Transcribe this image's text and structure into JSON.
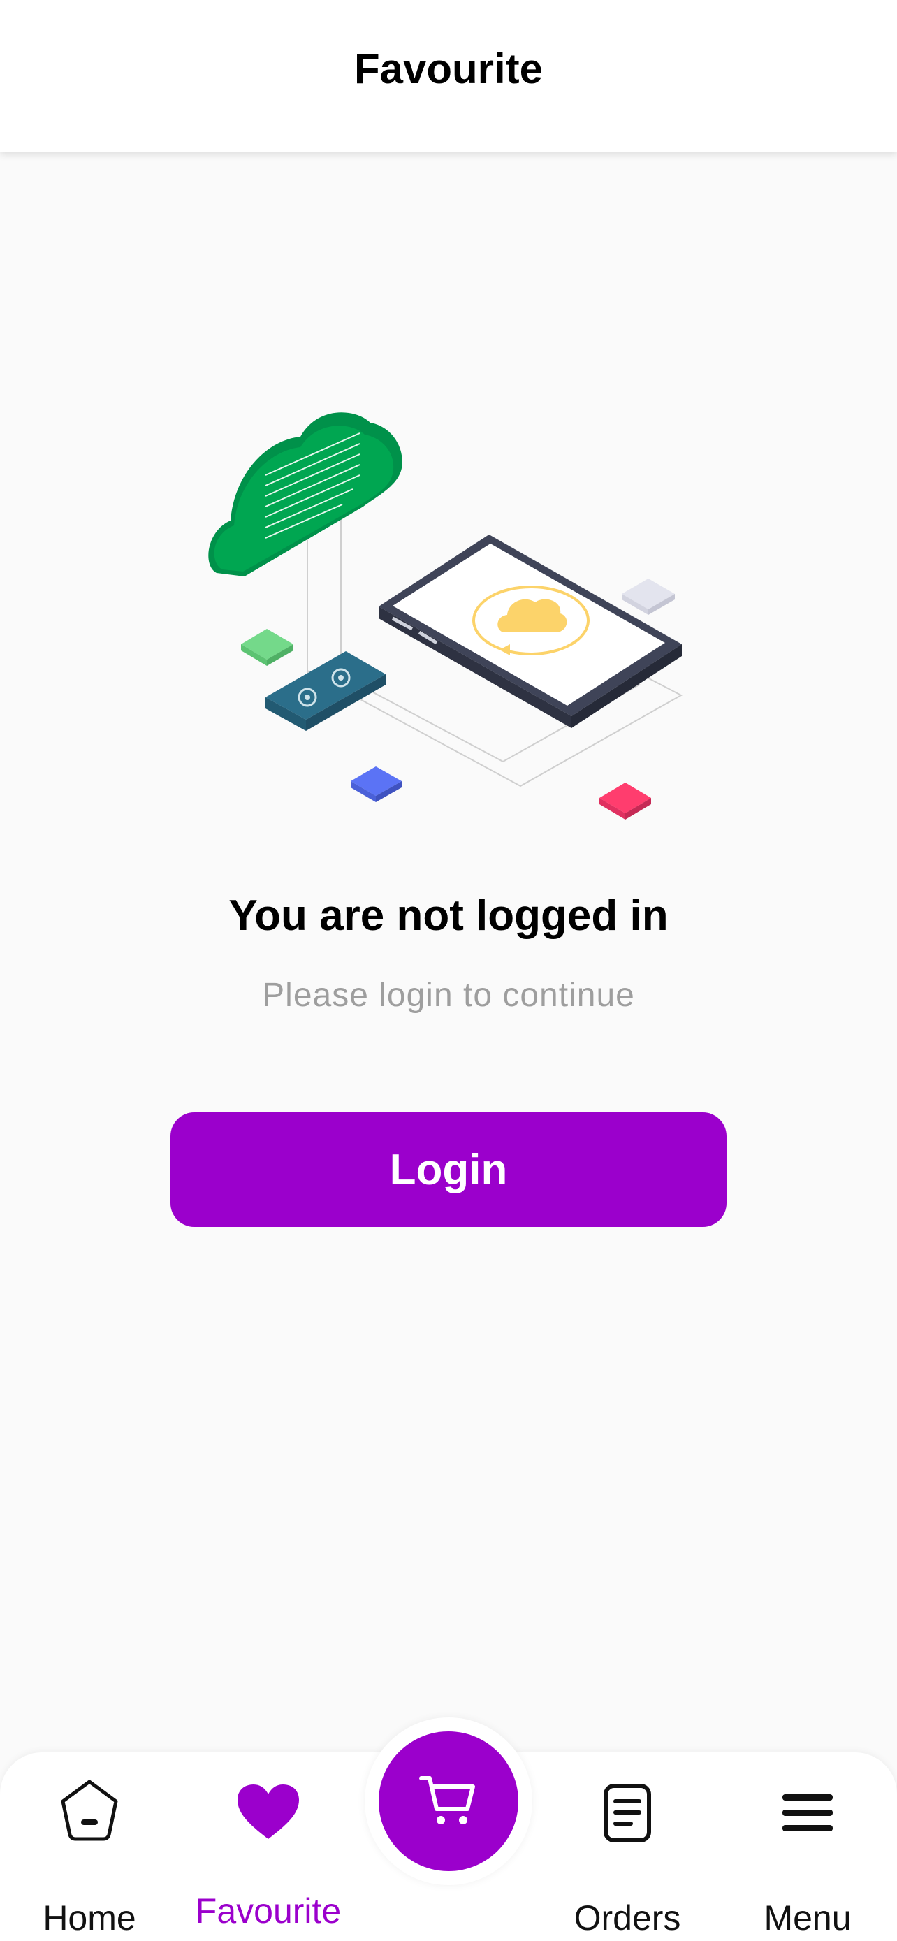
{
  "header": {
    "title": "Favourite"
  },
  "empty_state": {
    "title": "You are not logged in",
    "subtitle": "Please login to continue",
    "login_label": "Login"
  },
  "bottom_nav": {
    "items": [
      {
        "label": "Home",
        "icon": "home-icon",
        "active": false
      },
      {
        "label": "Favourite",
        "icon": "heart-icon",
        "active": true
      },
      {
        "label": "Orders",
        "icon": "orders-icon",
        "active": false
      },
      {
        "label": "Menu",
        "icon": "menu-icon",
        "active": false
      }
    ],
    "center": {
      "icon": "cart-icon"
    }
  },
  "colors": {
    "accent": "#9b00cc",
    "background": "#fafafa"
  }
}
